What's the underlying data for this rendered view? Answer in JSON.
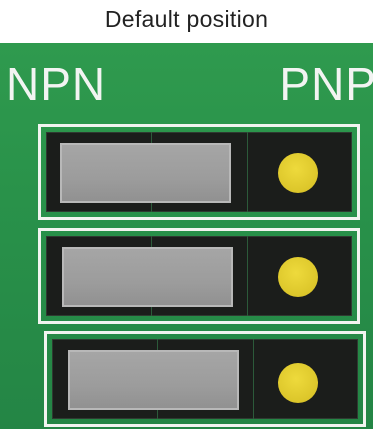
{
  "caption": "Default position",
  "board": {
    "left_label": "NPN",
    "right_label": "PNP"
  },
  "switches": [
    {
      "position": "NPN",
      "indicator": "yellow-led"
    },
    {
      "position": "NPN",
      "indicator": "yellow-led"
    },
    {
      "position": "NPN",
      "indicator": "yellow-led"
    }
  ],
  "colors": {
    "board": "#2b944b",
    "border": "#f2f4f0",
    "switch_body": "#1b1d1b",
    "actuator": "#9e9e9e",
    "led": "#dcc62a"
  }
}
